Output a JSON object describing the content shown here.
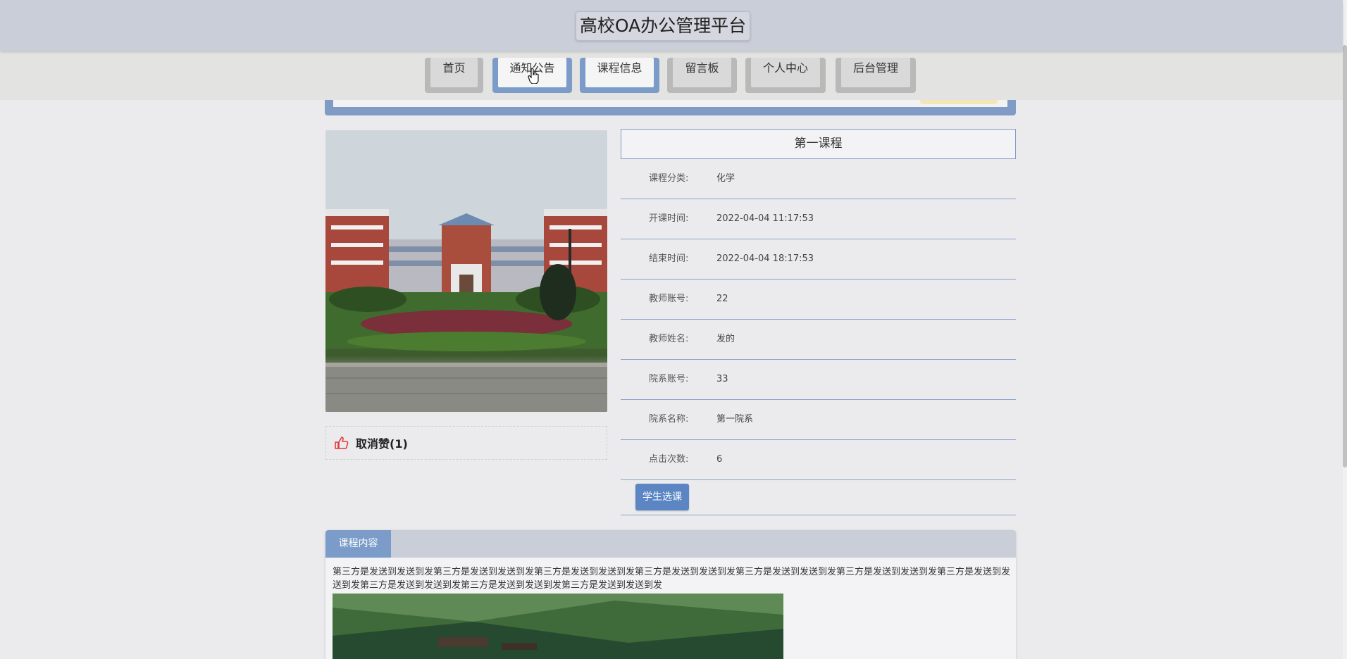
{
  "header": {
    "title": "高校OA办公管理平台"
  },
  "nav": {
    "items": [
      {
        "label": "首页"
      },
      {
        "label": "通知公告"
      },
      {
        "label": "课程信息"
      },
      {
        "label": "留言板"
      },
      {
        "label": "个人中心"
      },
      {
        "label": "后台管理"
      }
    ]
  },
  "course": {
    "title": "第一课程",
    "fields": [
      {
        "key": "课程分类:",
        "value": "化学"
      },
      {
        "key": "开课时间:",
        "value": "2022-04-04 11:17:53"
      },
      {
        "key": "结束时间:",
        "value": "2022-04-04 18:17:53"
      },
      {
        "key": "教师账号:",
        "value": "22"
      },
      {
        "key": "教师姓名:",
        "value": "发的"
      },
      {
        "key": "院系账号:",
        "value": "33"
      },
      {
        "key": "院系名称:",
        "value": "第一院系"
      },
      {
        "key": "点击次数:",
        "value": "6"
      }
    ],
    "select_button": "学生选课"
  },
  "like": {
    "label": "取消赞(1)",
    "icon": "thumbs-up-icon",
    "color": "#e23b3b"
  },
  "content": {
    "tab_label": "课程内容",
    "text": "第三方是发送到发送到发第三方是发送到发送到发第三方是发送到发送到发第三方是发送到发送到发第三方是发送到发送到发第三方是发送到发送到发第三方是发送到发送到发第三方是发送到发送到发第三方是发送到发送到发第三方是发送到发送到发"
  }
}
